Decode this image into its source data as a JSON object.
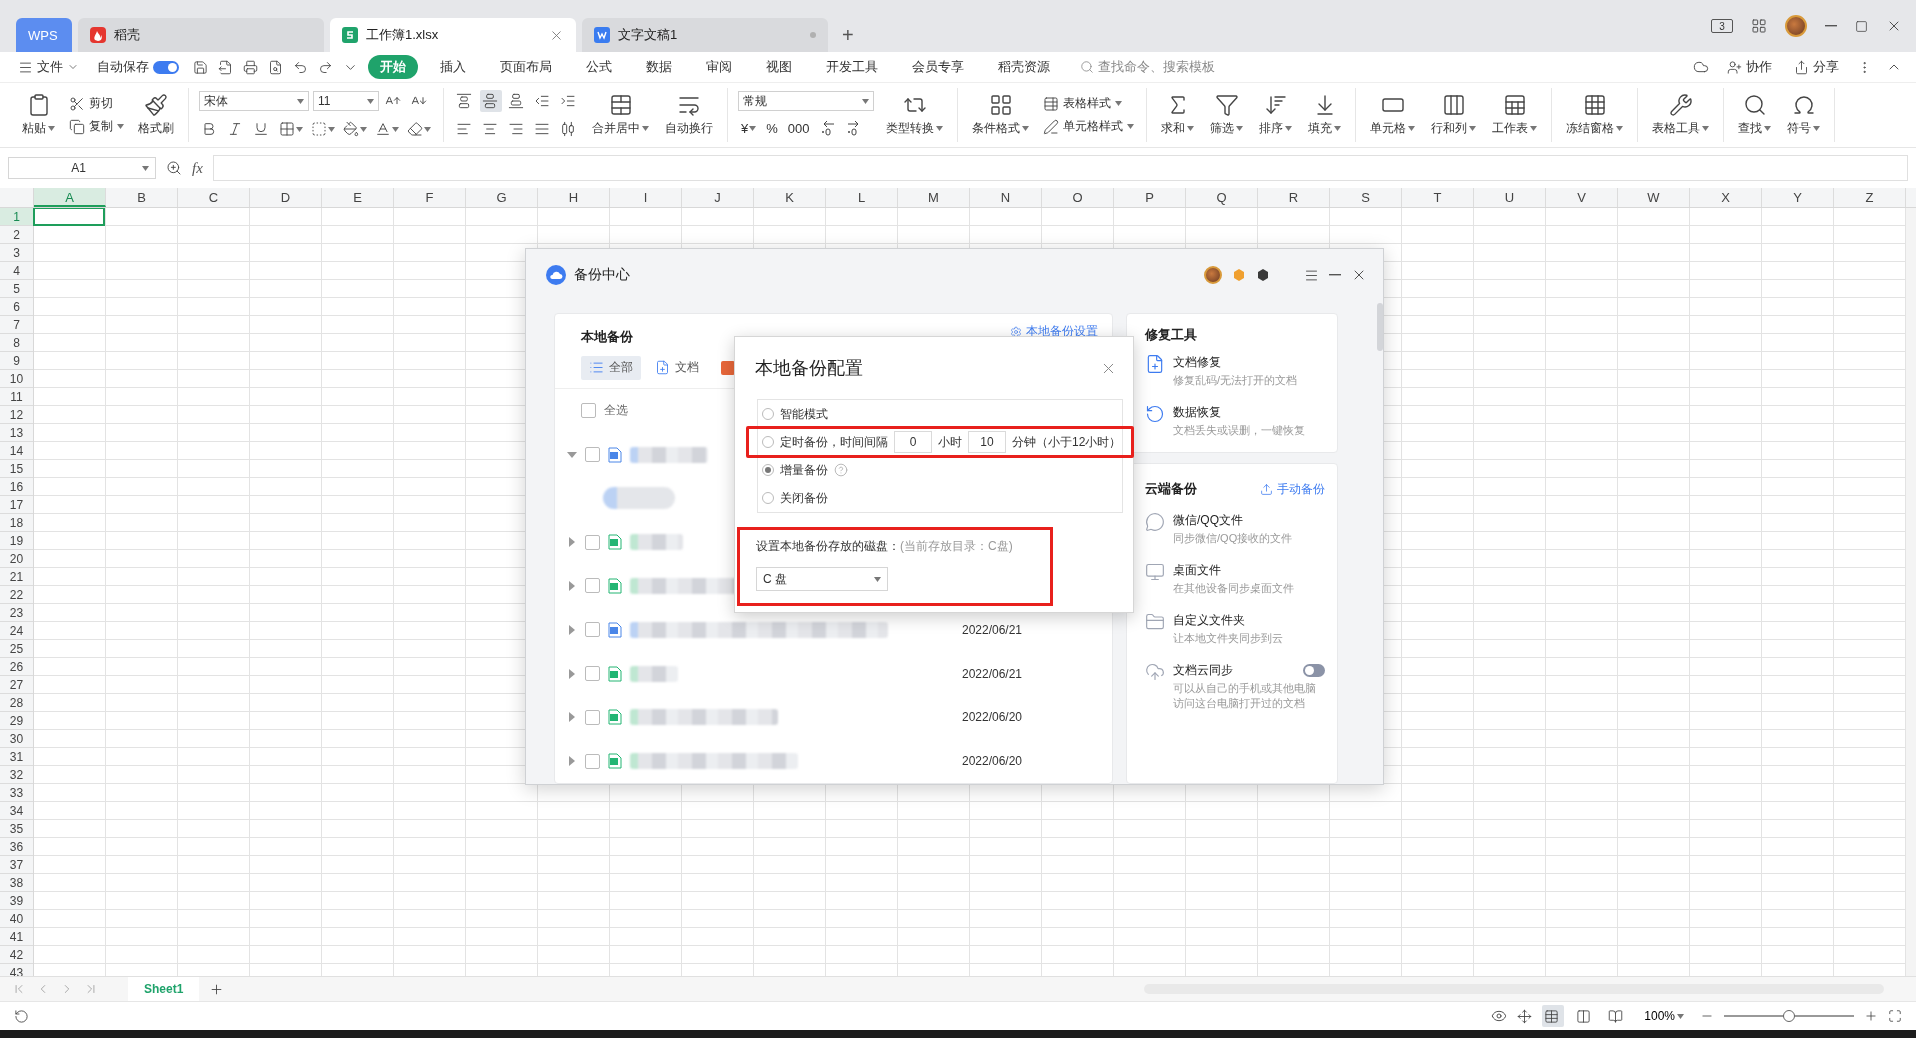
{
  "title_bar": {
    "tabs": [
      {
        "kind": "home",
        "label": "WPS",
        "selected": false,
        "modified": false
      },
      {
        "kind": "docer",
        "label": "稻壳",
        "selected": false,
        "modified": false
      },
      {
        "kind": "sheet",
        "label": "工作簿1.xlsx",
        "selected": true,
        "modified": false
      },
      {
        "kind": "doc",
        "label": "文字文稿1",
        "selected": false,
        "modified": true
      }
    ],
    "add": "+",
    "screen_count": "3"
  },
  "menu_bar": {
    "file": "文件",
    "autosave": {
      "label": "自动保存",
      "on": true
    },
    "tabs": [
      {
        "label": "开始",
        "selected": true
      },
      {
        "label": "插入",
        "selected": false
      },
      {
        "label": "页面布局",
        "selected": false
      },
      {
        "label": "公式",
        "selected": false
      },
      {
        "label": "数据",
        "selected": false
      },
      {
        "label": "审阅",
        "selected": false
      },
      {
        "label": "视图",
        "selected": false
      },
      {
        "label": "开发工具",
        "selected": false
      },
      {
        "label": "会员专享",
        "selected": false
      },
      {
        "label": "稻壳资源",
        "selected": false
      }
    ],
    "search": {
      "placeholder": "查找命令、搜索模板"
    },
    "collaborate": "协作",
    "share": "分享"
  },
  "ribbon": [
    {
      "columns": [
        {
          "kind": "large",
          "label": "粘贴",
          "dropdown": true
        },
        {
          "kind": "stack",
          "rows": [
            [
              {
                "kind": "small",
                "label": "剪切",
                "dropdown": false
              }
            ],
            [
              {
                "kind": "small",
                "label": "复制",
                "dropdown": true
              }
            ]
          ]
        },
        {
          "kind": "large",
          "label": "格式刷",
          "dropdown": false
        }
      ]
    },
    {
      "columns": [
        {
          "kind": "stack",
          "rows": [
            [
              {
                "kind": "select",
                "value": "宋体"
              },
              {
                "kind": "select",
                "value": "11"
              },
              {
                "kind": "icon",
                "dropdown": false
              },
              {
                "kind": "icon",
                "dropdown": false
              }
            ],
            [
              {
                "kind": "icon",
                "dropdown": false
              },
              {
                "kind": "icon",
                "dropdown": false
              },
              {
                "kind": "icon",
                "dropdown": false
              },
              {
                "kind": "icon",
                "dropdown": true
              },
              {
                "kind": "icon",
                "dropdown": true
              },
              {
                "kind": "icon",
                "dropdown": true
              },
              {
                "kind": "icon",
                "dropdown": true
              },
              {
                "kind": "icon",
                "dropdown": true
              }
            ]
          ]
        }
      ]
    },
    {
      "columns": [
        {
          "kind": "stack",
          "rows": [
            [
              {
                "kind": "icon",
                "dropdown": false,
                "selected": false
              },
              {
                "kind": "icon",
                "dropdown": false,
                "selected": true
              },
              {
                "kind": "icon",
                "dropdown": false,
                "selected": false
              },
              {
                "kind": "icon",
                "dropdown": false
              },
              {
                "kind": "icon",
                "dropdown": false
              }
            ],
            [
              {
                "kind": "icon",
                "dropdown": false,
                "selected": false
              },
              {
                "kind": "icon",
                "dropdown": false,
                "selected": false
              },
              {
                "kind": "icon",
                "dropdown": false,
                "selected": false
              },
              {
                "kind": "icon",
                "dropdown": false,
                "selected": false
              },
              {
                "kind": "icon",
                "dropdown": false,
                "selected": false
              }
            ]
          ]
        },
        {
          "kind": "large",
          "label": "合并居中",
          "dropdown": true
        },
        {
          "kind": "large",
          "label": "自动换行",
          "dropdown": false
        }
      ]
    },
    {
      "columns": [
        {
          "kind": "stack",
          "rows": [
            [
              {
                "kind": "select",
                "value": "常规"
              }
            ],
            [
              {
                "kind": "glyph",
                "text": "¥",
                "dropdown": true
              },
              {
                "kind": "glyph",
                "text": "%",
                "dropdown": false
              },
              {
                "kind": "glyph",
                "text": "000",
                "dropdown": false
              },
              {
                "kind": "icon",
                "dropdown": false
              },
              {
                "kind": "icon",
                "dropdown": false
              }
            ]
          ]
        },
        {
          "kind": "large",
          "label": "类型转换",
          "dropdown": true
        }
      ]
    },
    {
      "columns": [
        {
          "kind": "large",
          "label": "条件格式",
          "dropdown": true
        },
        {
          "kind": "stack",
          "rows": [
            [
              {
                "kind": "small",
                "label": "表格样式",
                "dropdown": true
              }
            ],
            [
              {
                "kind": "small",
                "label": "单元格样式",
                "dropdown": true
              }
            ]
          ]
        }
      ]
    },
    {
      "columns": [
        {
          "kind": "large",
          "label": "求和",
          "dropdown": true
        },
        {
          "kind": "large",
          "label": "筛选",
          "dropdown": true
        },
        {
          "kind": "large",
          "label": "排序",
          "dropdown": true
        },
        {
          "kind": "large",
          "label": "填充",
          "dropdown": true
        }
      ]
    },
    {
      "columns": [
        {
          "kind": "large",
          "label": "单元格",
          "dropdown": true
        },
        {
          "kind": "large",
          "label": "行和列",
          "dropdown": true
        },
        {
          "kind": "large",
          "label": "工作表",
          "dropdown": true
        }
      ]
    },
    {
      "columns": [
        {
          "kind": "large",
          "label": "冻结窗格",
          "dropdown": true
        }
      ]
    },
    {
      "columns": [
        {
          "kind": "large",
          "label": "表格工具",
          "dropdown": true
        }
      ]
    },
    {
      "columns": [
        {
          "kind": "large",
          "label": "查找",
          "dropdown": true
        },
        {
          "kind": "large",
          "label": "符号",
          "dropdown": true
        }
      ]
    }
  ],
  "formula_bar": {
    "name_box": "A1",
    "fx": "fx"
  },
  "sheet": {
    "columns": [
      {
        "label": "A",
        "selected": true
      },
      {
        "label": "B",
        "selected": false
      },
      {
        "label": "C",
        "selected": false
      },
      {
        "label": "D",
        "selected": false
      },
      {
        "label": "E",
        "selected": false
      },
      {
        "label": "F",
        "selected": false
      },
      {
        "label": "G",
        "selected": false
      },
      {
        "label": "H",
        "selected": false
      },
      {
        "label": "I",
        "selected": false
      },
      {
        "label": "J",
        "selected": false
      },
      {
        "label": "K",
        "selected": false
      },
      {
        "label": "L",
        "selected": false
      },
      {
        "label": "M",
        "selected": false
      },
      {
        "label": "N",
        "selected": false
      },
      {
        "label": "O",
        "selected": false
      },
      {
        "label": "P",
        "selected": false
      },
      {
        "label": "Q",
        "selected": false
      },
      {
        "label": "R",
        "selected": false
      },
      {
        "label": "S",
        "selected": false
      },
      {
        "label": "T",
        "selected": false
      },
      {
        "label": "U",
        "selected": false
      },
      {
        "label": "V",
        "selected": false
      },
      {
        "label": "W",
        "selected": false
      },
      {
        "label": "X",
        "selected": false
      },
      {
        "label": "Y",
        "selected": false
      },
      {
        "label": "Z",
        "selected": false
      }
    ],
    "rows": [
      {
        "label": "1",
        "selected": true
      },
      {
        "label": "2",
        "selected": false
      },
      {
        "label": "3",
        "selected": false
      },
      {
        "label": "4",
        "selected": false
      },
      {
        "label": "5",
        "selected": false
      },
      {
        "label": "6",
        "selected": false
      },
      {
        "label": "7",
        "selected": false
      },
      {
        "label": "8",
        "selected": false
      },
      {
        "label": "9",
        "selected": false
      },
      {
        "label": "10",
        "selected": false
      },
      {
        "label": "11",
        "selected": false
      },
      {
        "label": "12",
        "selected": false
      },
      {
        "label": "13",
        "selected": false
      },
      {
        "label": "14",
        "selected": false
      },
      {
        "label": "15",
        "selected": false
      },
      {
        "label": "16",
        "selected": false
      },
      {
        "label": "17",
        "selected": false
      },
      {
        "label": "18",
        "selected": false
      },
      {
        "label": "19",
        "selected": false
      },
      {
        "label": "20",
        "selected": false
      },
      {
        "label": "21",
        "selected": false
      },
      {
        "label": "22",
        "selected": false
      },
      {
        "label": "23",
        "selected": false
      },
      {
        "label": "24",
        "selected": false
      },
      {
        "label": "25",
        "selected": false
      },
      {
        "label": "26",
        "selected": false
      },
      {
        "label": "27",
        "selected": false
      },
      {
        "label": "28",
        "selected": false
      },
      {
        "label": "29",
        "selected": false
      },
      {
        "label": "30",
        "selected": false
      },
      {
        "label": "31",
        "selected": false
      },
      {
        "label": "32",
        "selected": false
      },
      {
        "label": "33",
        "selected": false
      },
      {
        "label": "34",
        "selected": false
      },
      {
        "label": "35",
        "selected": false
      },
      {
        "label": "36",
        "selected": false
      },
      {
        "label": "37",
        "selected": false
      },
      {
        "label": "38",
        "selected": false
      },
      {
        "label": "39",
        "selected": false
      },
      {
        "label": "40",
        "selected": false
      },
      {
        "label": "41",
        "selected": false
      },
      {
        "label": "42",
        "selected": false
      },
      {
        "label": "43",
        "selected": false
      }
    ]
  },
  "sheet_tabs": [
    {
      "label": "Sheet1",
      "selected": true
    }
  ],
  "status_bar": {
    "zoom": "100%",
    "zoom_slider": {
      "level": 0.5
    }
  },
  "backup_center": {
    "title": "备份中心",
    "local": {
      "title": "本地备份",
      "settings_link": "本地备份设置",
      "filters": [
        {
          "kind": "all",
          "label": "全部",
          "selected": true
        },
        {
          "kind": "doc",
          "label": "文档",
          "selected": false
        },
        {
          "kind": "slides",
          "selected": false
        }
      ],
      "select_all": {
        "label": "全选",
        "checked": false
      },
      "items": [
        {
          "kind": "doc",
          "expanded": true,
          "checked": false,
          "children": [
            {
              "kind": "blurred"
            }
          ]
        },
        {
          "kind": "sheet",
          "expanded": false,
          "checked": false
        },
        {
          "kind": "sheet",
          "expanded": false,
          "checked": false
        },
        {
          "kind": "doc",
          "expanded": false,
          "checked": false,
          "date": "2022/06/21"
        },
        {
          "kind": "sheet",
          "expanded": false,
          "checked": false,
          "date": "2022/06/21"
        },
        {
          "kind": "sheet",
          "expanded": false,
          "checked": false,
          "date": "2022/06/20"
        },
        {
          "kind": "sheet",
          "expanded": false,
          "checked": false,
          "date": "2022/06/20"
        }
      ]
    },
    "repair_tools": {
      "title": "修复工具",
      "items": [
        {
          "title": "文档修复",
          "desc": "修复乱码/无法打开的文档"
        },
        {
          "title": "数据恢复",
          "desc": "文档丢失或误删，一键恢复"
        }
      ]
    },
    "cloud_backup": {
      "title": "云端备份",
      "action": "手动备份",
      "items": [
        {
          "kind": "link",
          "title": "微信/QQ文件",
          "desc": "同步微信/QQ接收的文件"
        },
        {
          "kind": "link",
          "title": "桌面文件",
          "desc": "在其他设备同步桌面文件"
        },
        {
          "kind": "link",
          "title": "自定义文件夹",
          "desc": "让本地文件夹同步到云"
        },
        {
          "kind": "toggle",
          "title": "文档云同步",
          "desc": "可以从自己的手机或其他电脑访问这台电脑打开过的文档",
          "on": false
        }
      ]
    }
  },
  "config_dialog": {
    "title": "本地备份配置",
    "modes": [
      {
        "kind": "plain",
        "label": "智能模式",
        "selected": false,
        "highlighted": false
      },
      {
        "kind": "interval",
        "label": "定时备份，时间间隔",
        "hours": "0",
        "hours_unit": "小时",
        "minutes": "10",
        "minutes_unit": "分钟（小于12小时）",
        "selected": false,
        "highlighted": true
      },
      {
        "kind": "help",
        "label": "增量备份",
        "selected": true,
        "highlighted": false
      },
      {
        "kind": "plain",
        "label": "关闭备份",
        "selected": false,
        "highlighted": false
      }
    ],
    "disk": {
      "label": "设置本地备份存放的磁盘：",
      "note": "(当前存放目录：C盘)",
      "value": "C 盘",
      "highlighted": true
    }
  }
}
